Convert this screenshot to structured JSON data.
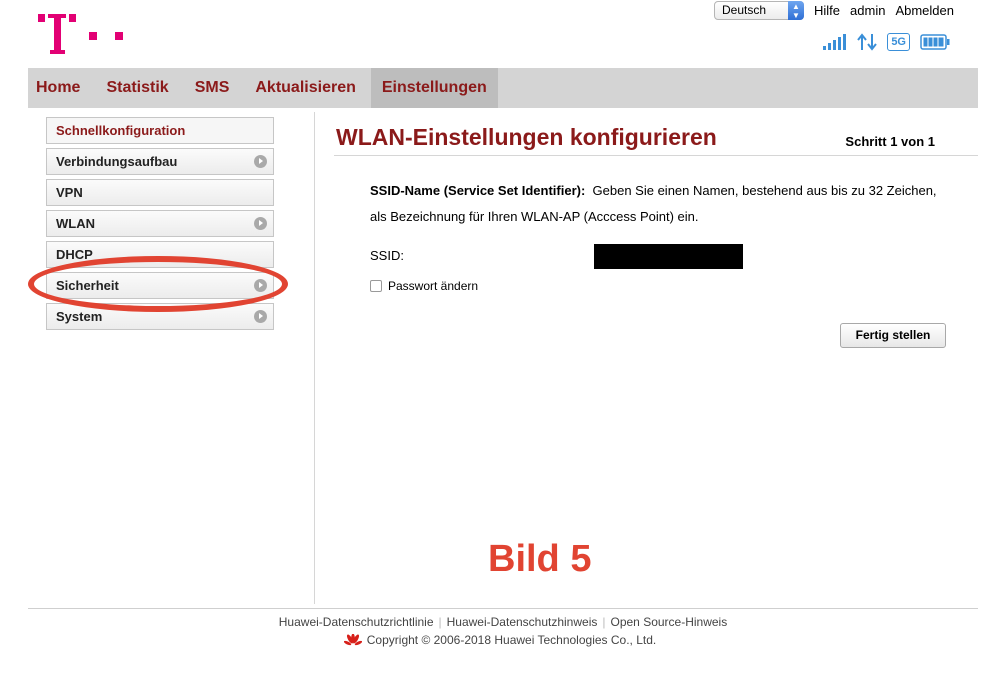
{
  "header": {
    "language": "Deutsch",
    "help": "Hilfe",
    "user": "admin",
    "logout": "Abmelden",
    "network_badge": "5G"
  },
  "nav": {
    "home": "Home",
    "statistik": "Statistik",
    "sms": "SMS",
    "aktualisieren": "Aktualisieren",
    "einstellungen": "Einstellungen"
  },
  "sidebar": {
    "items": [
      {
        "label": "Schnellkonfiguration",
        "selected": true,
        "has_arrow": false
      },
      {
        "label": "Verbindungsaufbau",
        "has_arrow": true
      },
      {
        "label": "VPN",
        "has_arrow": false
      },
      {
        "label": "WLAN",
        "has_arrow": true
      },
      {
        "label": "DHCP",
        "has_arrow": false
      },
      {
        "label": "Sicherheit",
        "has_arrow": true,
        "highlighted": true
      },
      {
        "label": "System",
        "has_arrow": true
      }
    ]
  },
  "main": {
    "title": "WLAN-Einstellungen konfigurieren",
    "step": "Schritt 1 von 1",
    "desc_bold": "SSID-Name (Service Set Identifier):",
    "desc_text": "Geben Sie einen Namen, bestehend aus bis zu 32 Zeichen, als Bezeichnung für Ihren WLAN-AP (Acccess Point) ein.",
    "ssid_label": "SSID:",
    "ssid_value": "",
    "password_change": "Passwort ändern",
    "finish_button": "Fertig stellen"
  },
  "annotation": "Bild 5",
  "footer": {
    "links": [
      "Huawei-Datenschutzrichtlinie",
      "Huawei-Datenschutzhinweis",
      "Open Source-Hinweis"
    ],
    "copyright": "Copyright © 2006-2018 Huawei Technologies Co., Ltd."
  },
  "colors": {
    "brand_magenta": "#e20074",
    "nav_text": "#8b1a1a",
    "annotation_red": "#e14432",
    "signal_blue": "#3a8fd8"
  }
}
